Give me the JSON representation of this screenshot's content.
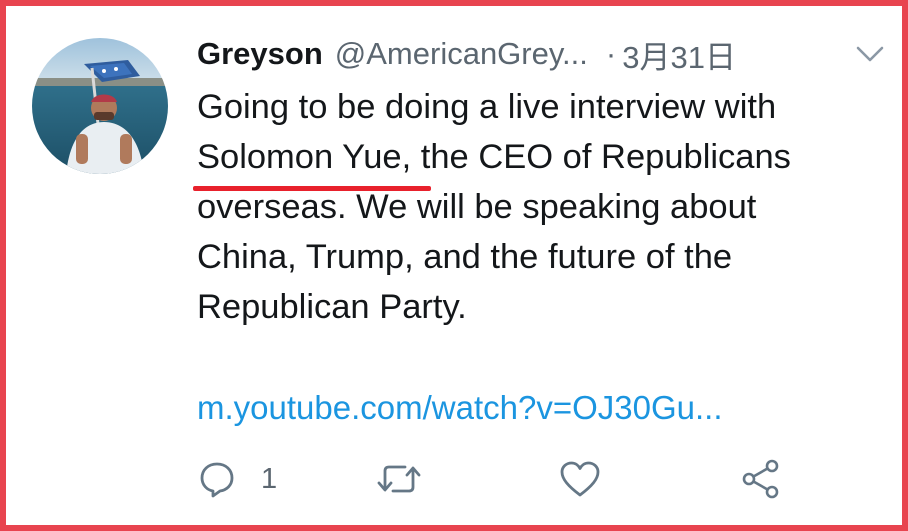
{
  "tweet": {
    "display_name": "Greyson",
    "handle": "@AmericanGrey...",
    "separator": "·",
    "date": "3月31日",
    "text_lines": [
      "Going to be doing a live interview with",
      "overseas. We will be speaking about",
      "China, Trump, and the future of the",
      "Republican Party."
    ],
    "mentioned_name": "Solomon Yue",
    "line2_rest": ", the CEO of Republicans",
    "link": "m.youtube.com/watch?v=OJ30Gu...",
    "reply_count": "1"
  },
  "icons": {
    "menu": "chevron-down-icon",
    "reply": "comment-bubble-icon",
    "retweet": "retweet-icon",
    "like": "heart-icon",
    "share": "share-icon"
  },
  "colors": {
    "frame_border": "#e8444f",
    "highlight_underline": "#e8212c",
    "link": "#1b95e0",
    "secondary_text": "#5b6670",
    "primary_text": "#14171a"
  }
}
